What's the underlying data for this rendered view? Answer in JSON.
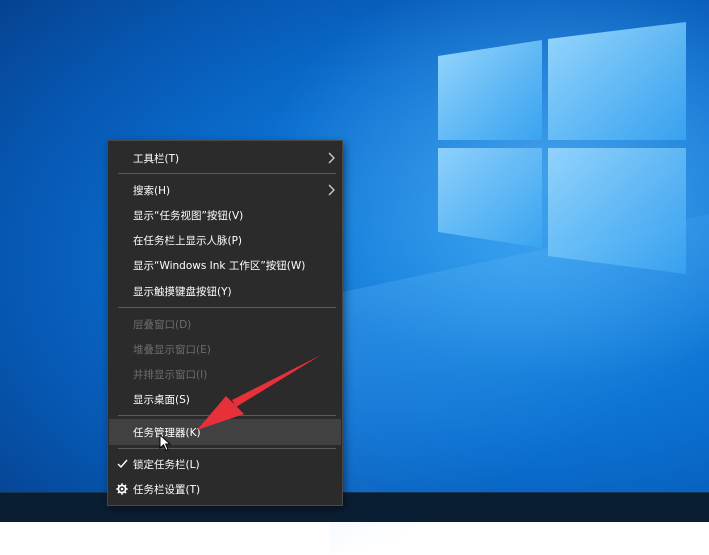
{
  "menu": {
    "items": [
      {
        "label": "工具栏(T)",
        "state": "normal",
        "submenu": true
      },
      {
        "label": "搜索(H)",
        "state": "normal",
        "submenu": true
      },
      {
        "label": "显示“任务视图”按钮(V)",
        "state": "normal"
      },
      {
        "label": "在任务栏上显示人脉(P)",
        "state": "normal"
      },
      {
        "label": "显示“Windows Ink 工作区”按钮(W)",
        "state": "normal"
      },
      {
        "label": "显示触摸键盘按钮(Y)",
        "state": "normal"
      },
      {
        "label": "层叠窗口(D)",
        "state": "disabled"
      },
      {
        "label": "堆叠显示窗口(E)",
        "state": "disabled"
      },
      {
        "label": "并排显示窗口(I)",
        "state": "disabled"
      },
      {
        "label": "显示桌面(S)",
        "state": "normal"
      },
      {
        "label": "任务管理器(K)",
        "state": "hover"
      },
      {
        "label": "锁定任务栏(L)",
        "state": "checked",
        "icon": "checkmark-icon"
      },
      {
        "label": "任务栏设置(T)",
        "state": "normal",
        "icon": "gear-icon"
      }
    ]
  },
  "colors": {
    "menu_bg": "#2b2b2b",
    "hover_bg": "#414141",
    "disabled_text": "#6d6d6d",
    "annotation_arrow": "#e8303a"
  }
}
